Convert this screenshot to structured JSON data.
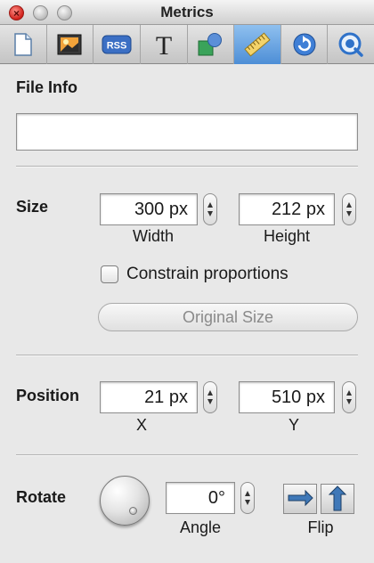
{
  "window": {
    "title": "Metrics",
    "controls": [
      "close",
      "minimize",
      "zoom"
    ]
  },
  "toolbar": {
    "items": [
      {
        "icon": "document-icon"
      },
      {
        "icon": "photo-icon"
      },
      {
        "icon": "rss-icon",
        "label": "RSS"
      },
      {
        "icon": "text-icon",
        "label": "T"
      },
      {
        "icon": "shapes-icon"
      },
      {
        "icon": "ruler-icon",
        "active": true
      },
      {
        "icon": "refresh-icon"
      },
      {
        "icon": "quicktime-icon"
      }
    ]
  },
  "file_info": {
    "label": "File Info",
    "value": ""
  },
  "size": {
    "label": "Size",
    "width": {
      "value": "300 px",
      "caption": "Width"
    },
    "height": {
      "value": "212 px",
      "caption": "Height"
    },
    "constrain": {
      "label": "Constrain proportions",
      "checked": false
    },
    "original_size_label": "Original Size"
  },
  "position": {
    "label": "Position",
    "x": {
      "value": "21 px",
      "caption": "X"
    },
    "y": {
      "value": "510 px",
      "caption": "Y"
    }
  },
  "rotate": {
    "label": "Rotate",
    "angle": {
      "value": "0°",
      "caption": "Angle"
    },
    "flip_caption": "Flip"
  },
  "colors": {
    "active_tab": "#5b9ddf",
    "close_button": "#d0201a",
    "background": "#e8e8e8"
  }
}
